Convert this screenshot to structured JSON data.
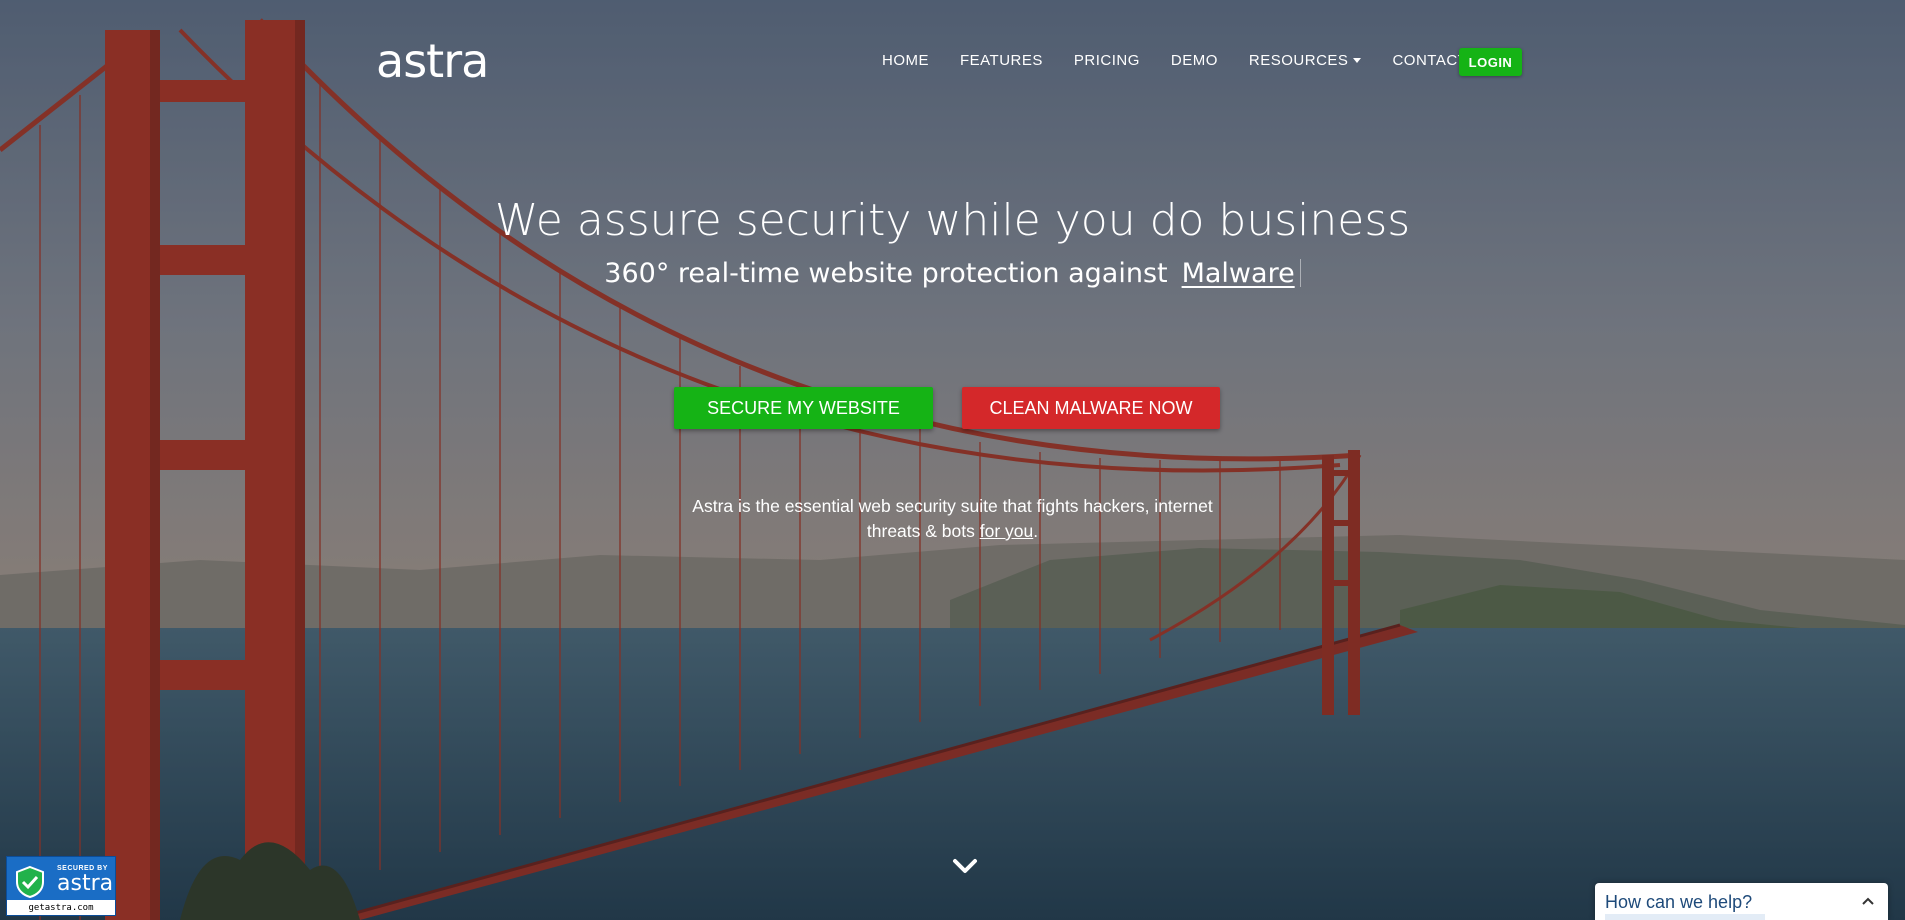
{
  "header": {
    "logo_text": "astra",
    "nav": [
      {
        "label": "HOME"
      },
      {
        "label": "FEATURES"
      },
      {
        "label": "PRICING"
      },
      {
        "label": "DEMO"
      },
      {
        "label": "RESOURCES"
      },
      {
        "label": "CONTACT"
      }
    ],
    "login_label": "LOGIN"
  },
  "hero": {
    "title": "We assure security while you do business",
    "subtitle": "360° real-time website protection against",
    "rotating_word": "Malware",
    "cta_primary": "SECURE MY WEBSITE",
    "cta_secondary": "CLEAN MALWARE NOW",
    "description_part1": "Astra is the essential web security suite that fights hackers, internet",
    "description_part2": "threats & bots ",
    "description_link": "for you",
    "description_end": "."
  },
  "badge": {
    "secured_label": "SECURED BY",
    "brand": "astra",
    "url": "getastra.com"
  },
  "chat": {
    "prompt": "How can we help?"
  },
  "colors": {
    "green": "#15b315",
    "red": "#d4282a",
    "badge_blue": "#1a6dc5"
  },
  "icons": {
    "resources_caret": "caret-down-icon",
    "scroll": "chevron-down-icon",
    "chat_toggle": "chevron-up-icon",
    "badge_shield": "shield-check-icon"
  }
}
